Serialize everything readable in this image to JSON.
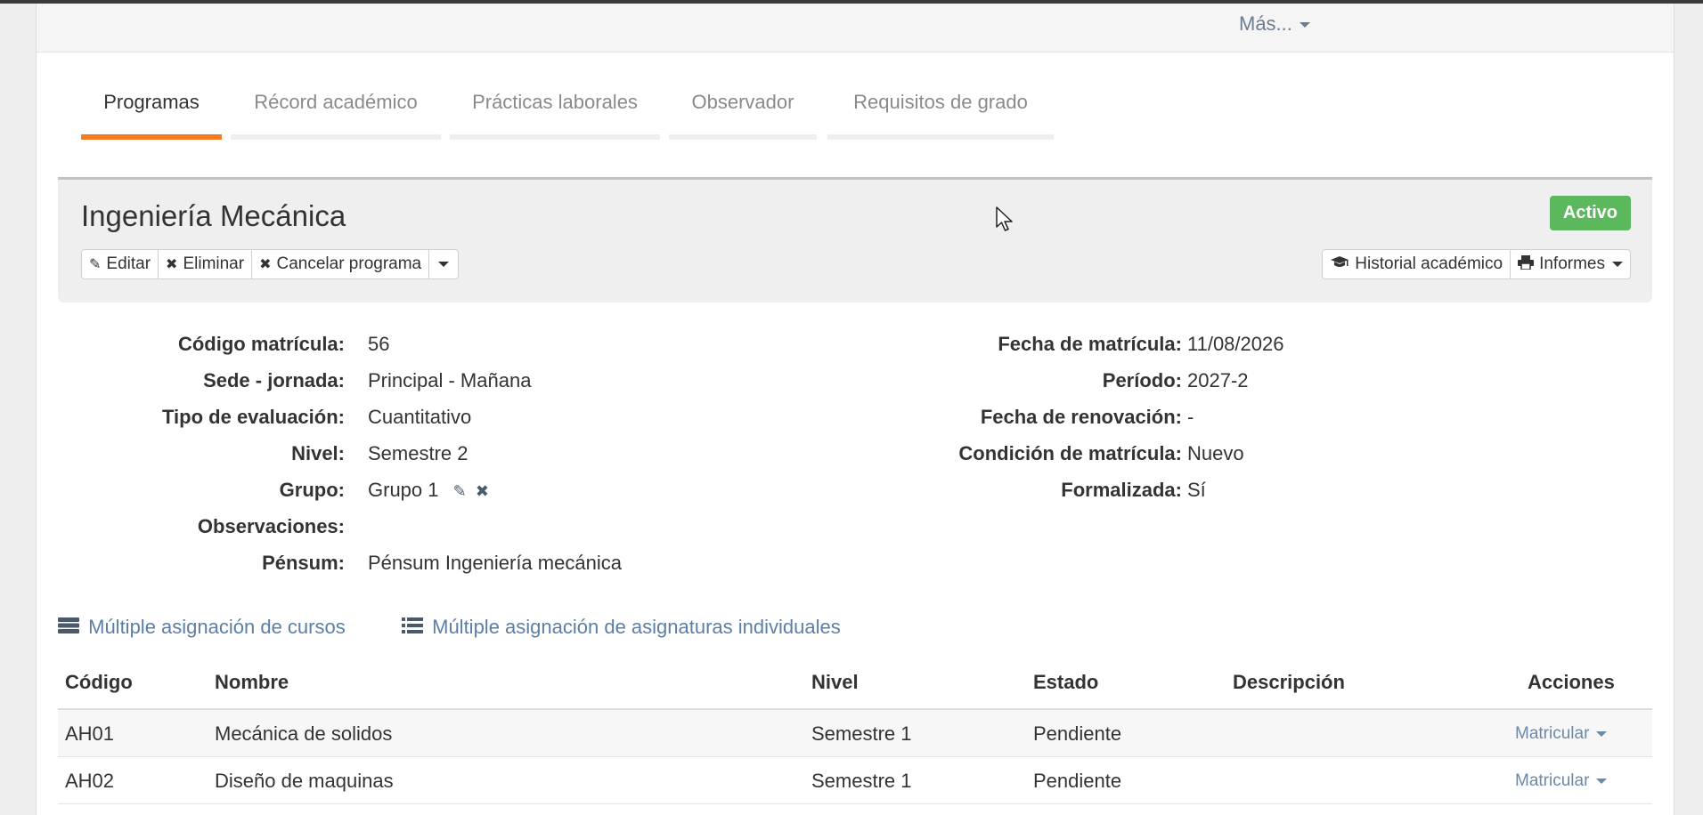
{
  "navbar": {
    "mas_label": "Más..."
  },
  "tabs": [
    {
      "label": "Programas"
    },
    {
      "label": "Récord académico"
    },
    {
      "label": "Prácticas laborales"
    },
    {
      "label": "Observador"
    },
    {
      "label": "Requisitos de grado"
    }
  ],
  "program": {
    "title": "Ingeniería Mecánica",
    "status": "Activo",
    "status_color": "#5cb85c",
    "actions": {
      "edit": "Editar",
      "delete": "Eliminar",
      "cancel": "Cancelar programa",
      "history": "Historial académico",
      "reports": "Informes"
    }
  },
  "details_left": [
    {
      "label": "Código matrícula:",
      "value": "56"
    },
    {
      "label": "Sede - jornada:",
      "value": "Principal - Mañana"
    },
    {
      "label": "Tipo de evaluación:",
      "value": "Cuantitativo"
    },
    {
      "label": "Nivel:",
      "value": "Semestre 2"
    },
    {
      "label": "Grupo:",
      "value": "Grupo 1"
    },
    {
      "label": "Observaciones:",
      "value": ""
    },
    {
      "label": "Pénsum:",
      "value": "Pénsum Ingeniería mecánica"
    }
  ],
  "details_right": [
    {
      "label": "Fecha de matrícula:",
      "value": "11/08/2026"
    },
    {
      "label": "Período:",
      "value": "2027-2"
    },
    {
      "label": "Fecha de renovación:",
      "value": "-"
    },
    {
      "label": "Condición de matrícula:",
      "value": "Nuevo"
    },
    {
      "label": "Formalizada:",
      "value": "Sí"
    }
  ],
  "links": {
    "multiple_courses": "Múltiple asignación de cursos",
    "multiple_subjects": "Múltiple asignación de asignaturas individuales"
  },
  "table": {
    "headers": {
      "code": "Código",
      "name": "Nombre",
      "level": "Nivel",
      "status": "Estado",
      "description": "Descripción",
      "actions": "Acciones"
    },
    "rows": [
      {
        "code": "AH01",
        "name": "Mecánica de solidos",
        "level": "Semestre 1",
        "status": "Pendiente",
        "description": "",
        "action": "Matricular"
      },
      {
        "code": "AH02",
        "name": "Diseño de maquinas",
        "level": "Semestre 1",
        "status": "Pendiente",
        "description": "",
        "action": "Matricular"
      }
    ]
  },
  "icons": {
    "edit": "pencil-icon",
    "delete": "times-icon",
    "history": "graduation-cap-icon",
    "reports": "print-icon",
    "courses": "server-icon",
    "subjects": "list-icon",
    "cursor": "mouse-pointer-icon"
  },
  "colors": {
    "tab_active": "#f47b20",
    "link": "#5b7fa6"
  }
}
